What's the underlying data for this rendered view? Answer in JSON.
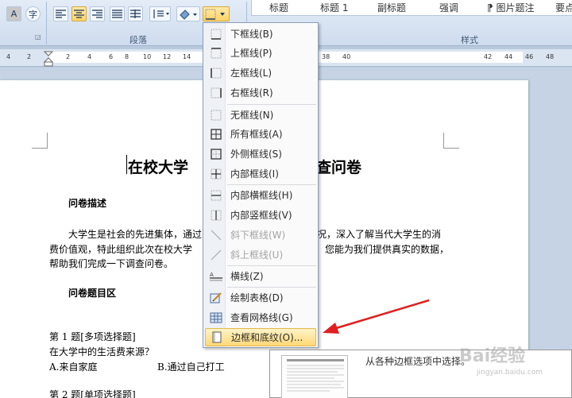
{
  "ribbon": {
    "group_paragraph": "段落",
    "group_styles": "样式",
    "styles": [
      "标题",
      "标题 1",
      "副标题",
      "强调",
      "图片题注",
      "要点"
    ],
    "btn_a": "A",
    "btn_char": "字"
  },
  "ruler": {
    "numbers": [
      "4",
      "2",
      "2",
      "4",
      "6",
      "8",
      "10",
      "12",
      "14",
      "38",
      "40",
      "42",
      "44",
      "46",
      "48"
    ]
  },
  "menu": {
    "items": [
      {
        "label": "下框线(B)",
        "icon": "bottom-border-icon",
        "disabled": false
      },
      {
        "label": "上框线(P)",
        "icon": "top-border-icon",
        "disabled": false
      },
      {
        "label": "左框线(L)",
        "icon": "left-border-icon",
        "disabled": false
      },
      {
        "label": "右框线(R)",
        "icon": "right-border-icon",
        "disabled": false
      },
      {
        "label": "无框线(N)",
        "icon": "no-border-icon",
        "disabled": false
      },
      {
        "label": "所有框线(A)",
        "icon": "all-borders-icon",
        "disabled": false
      },
      {
        "label": "外侧框线(S)",
        "icon": "outside-borders-icon",
        "disabled": false
      },
      {
        "label": "内部框线(I)",
        "icon": "inside-borders-icon",
        "disabled": false
      },
      {
        "label": "内部横框线(H)",
        "icon": "inside-horizontal-border-icon",
        "disabled": false
      },
      {
        "label": "内部竖框线(V)",
        "icon": "inside-vertical-border-icon",
        "disabled": false
      },
      {
        "label": "斜下框线(W)",
        "icon": "diagonal-down-border-icon",
        "disabled": true
      },
      {
        "label": "斜上框线(U)",
        "icon": "diagonal-up-border-icon",
        "disabled": true
      },
      {
        "label": "横线(Z)",
        "icon": "horizontal-line-icon",
        "disabled": false
      },
      {
        "label": "绘制表格(D)",
        "icon": "draw-table-icon",
        "disabled": false
      },
      {
        "label": "查看网格线(G)",
        "icon": "view-gridlines-icon",
        "disabled": false
      },
      {
        "label": "边框和底纹(O)...",
        "icon": "borders-shading-icon",
        "disabled": false
      }
    ]
  },
  "document": {
    "title_left": "在校大学",
    "title_right": "查问卷",
    "section1": "问卷描述",
    "para_line1_left": "大学生是社会的先进集体，通过",
    "para_line1_right": "况，深入了解当代大学生的消",
    "para_line2_left": "费价值观，特此组织此次在校大学",
    "para_line2_right": "您能为我们提供真实的数据，",
    "para_line3": "帮助我们完成一下调查问卷。",
    "section2": "问卷题目区",
    "q1_title": "第 1 题[多项选择题]",
    "q1_text": "在大学中的生活费来源？",
    "q1_opt_a": "A.来自家庭",
    "q1_opt_b": "B.通过自己打工",
    "q2_title": "第 2 题[单项选择题]"
  },
  "tooltip": {
    "text": "从各种边框选项中选择。"
  },
  "watermark": {
    "text": "Bai经验",
    "sub": "jingyan.baidu.com"
  },
  "colors": {
    "arrow": "#e02020",
    "highlight": "#ffd977"
  }
}
